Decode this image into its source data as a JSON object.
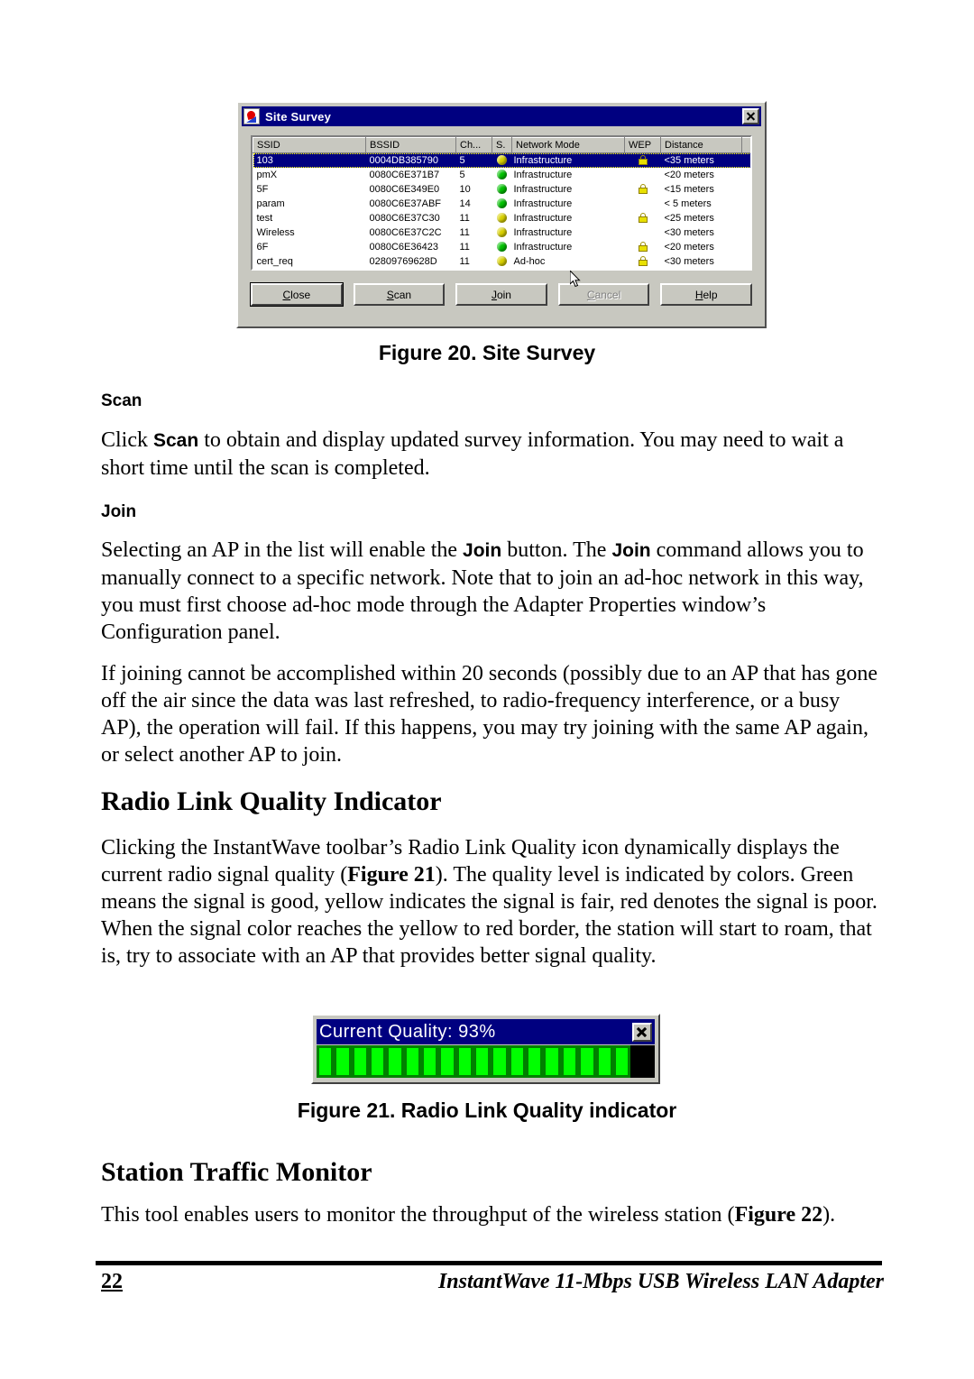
{
  "figure20": {
    "dialog": {
      "title": "Site Survey",
      "icon": "wireless-icon",
      "close_label": "×",
      "columns": [
        "SSID",
        "BSSID",
        "Ch...",
        "S.",
        "Network Mode",
        "WEP",
        "Distance",
        ""
      ],
      "rows": [
        {
          "ssid": "103",
          "bssid": "0004DB385790",
          "ch": "5",
          "signal": "yellow",
          "mode": "Infrastructure",
          "wep": true,
          "distance": "<35 meters",
          "selected": true
        },
        {
          "ssid": "pmX",
          "bssid": "0080C6E371B7",
          "ch": "5",
          "signal": "green",
          "mode": "Infrastructure",
          "wep": false,
          "distance": "<20 meters",
          "selected": false
        },
        {
          "ssid": "5F",
          "bssid": "0080C6E349E0",
          "ch": "10",
          "signal": "green",
          "mode": "Infrastructure",
          "wep": true,
          "distance": "<15 meters",
          "selected": false
        },
        {
          "ssid": "param",
          "bssid": "0080C6E37ABF",
          "ch": "14",
          "signal": "green",
          "mode": "Infrastructure",
          "wep": false,
          "distance": "< 5 meters",
          "selected": false
        },
        {
          "ssid": "test",
          "bssid": "0080C6E37C30",
          "ch": "11",
          "signal": "yellow",
          "mode": "Infrastructure",
          "wep": true,
          "distance": "<25 meters",
          "selected": false
        },
        {
          "ssid": "Wireless",
          "bssid": "0080C6E37C2C",
          "ch": "11",
          "signal": "yellow",
          "mode": "Infrastructure",
          "wep": false,
          "distance": "<30 meters",
          "selected": false
        },
        {
          "ssid": "6F",
          "bssid": "0080C6E36423",
          "ch": "11",
          "signal": "green",
          "mode": "Infrastructure",
          "wep": true,
          "distance": "<20 meters",
          "selected": false
        },
        {
          "ssid": "cert_req",
          "bssid": "02809769628D",
          "ch": "11",
          "signal": "yellow",
          "mode": "Ad-hoc",
          "wep": true,
          "distance": "<30 meters",
          "selected": false
        }
      ],
      "buttons": [
        {
          "label": "Close",
          "accel": "C",
          "state": "default"
        },
        {
          "label": "Scan",
          "accel": "S",
          "state": "normal"
        },
        {
          "label": "Join",
          "accel": "J",
          "state": "normal"
        },
        {
          "label": "Cancel",
          "accel": "C",
          "state": "disabled"
        },
        {
          "label": "Help",
          "accel": "H",
          "state": "normal"
        }
      ]
    },
    "caption": "Figure 20.  Site Survey"
  },
  "sections": {
    "scan_heading": "Scan",
    "scan_para_1": "Click ",
    "scan_para_bold": "Scan",
    "scan_para_2": " to obtain and display updated survey information. You may need to wait a short time until the scan is completed.",
    "join_heading": "Join",
    "join_para_a_1": "Selecting an AP in the list will enable the ",
    "join_para_a_b1": "Join",
    "join_para_a_2": " button. The ",
    "join_para_a_b2": "Join",
    "join_para_a_3": " command allows you to manually connect to a specific network. Note that to join an ad-hoc network in this way, you must first choose ad-hoc mode through the Adapter Properties window’s Configuration panel.",
    "join_para_b": "If joining cannot be accomplished within 20 seconds (possibly due to an AP that has gone off the air since the data was last refreshed, to radio-frequency interference, or a busy AP), the operation will fail. If this happens, you may try joining with the same AP again, or select another AP to join.",
    "radio_heading": "Radio Link Quality Indicator",
    "radio_para_1": "Clicking the InstantWave toolbar’s Radio Link Quality icon dynamically displays the current radio signal quality (",
    "radio_para_fig": "Figure 21",
    "radio_para_2": "). The quality level is indicated by colors. Green means the signal is good, yellow indicates the signal is fair, red denotes the signal is poor. When the signal color reaches the yellow to red border, the station will start to roam, that is, try to associate with an AP that provides better signal quality.",
    "station_heading": "Station Traffic Monitor",
    "station_para_1": "This tool enables users to monitor the throughput of the wireless station (",
    "station_para_fig": "Figure 22",
    "station_para_2": ")."
  },
  "figure21": {
    "widget": {
      "title": "Current Quality:  93%",
      "quality_percent": 93,
      "close_label": "×",
      "segments_total": 20,
      "segments_filled": 18,
      "bar_color": "#00ff00",
      "bar_border_color": "#008000",
      "background_color": "#000000"
    },
    "caption": "Figure 21.  Radio Link Quality indicator"
  },
  "footer": {
    "page_number": "22",
    "document_title": "InstantWave 11-Mbps USB Wireless LAN Adapter"
  }
}
